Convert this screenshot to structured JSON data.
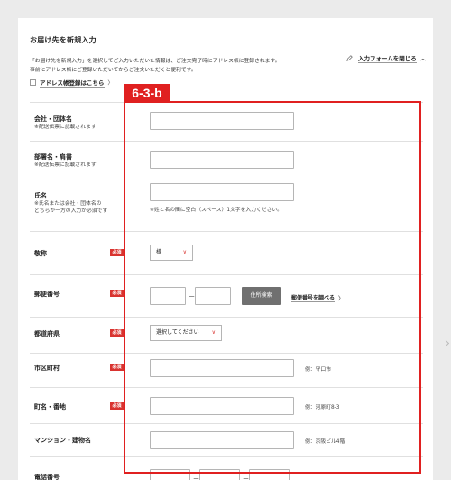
{
  "form": {
    "title": "お届け先を新規入力",
    "description": [
      "「お届け先を新規入力」を選択してご入力いただいた情報は、ご注文完了時にアドレス帳に登録されます。",
      "事前にアドレス帳にご登録いただいてからご注文いただくと便利です。"
    ],
    "close_label": "入力フォームを閉じる",
    "close_chevron": "︿",
    "address_book_label": "アドレス帳登録はこちら",
    "address_book_chevron": "〉"
  },
  "required_badge": "必須",
  "fields": {
    "company": {
      "label": "会社・団体名",
      "note": "※配送伝票に記載されます"
    },
    "department": {
      "label": "部署名・肩書",
      "note": "※配送伝票に記載されます"
    },
    "name": {
      "label": "氏名",
      "note1": "※氏名または会社・団体名の",
      "note2": "どちらか一方の入力が必須です",
      "hint": "※姓と名の間に空白（スペース）1文字を入力ください。"
    },
    "honorific": {
      "label": "敬称",
      "value": "様"
    },
    "postal": {
      "label": "郵便番号",
      "dash": "ー",
      "button": "住所検索",
      "link": "郵便番号を調べる",
      "link_chevron": "〉"
    },
    "prefecture": {
      "label": "都道府県",
      "value": "選択してください"
    },
    "city": {
      "label": "市区町村",
      "hint": "例：守口市"
    },
    "town": {
      "label": "町名・番地",
      "hint": "例：河原町8-3"
    },
    "building": {
      "label": "マンション・建物名",
      "hint": "例：京阪ビル4階"
    },
    "phone": {
      "label": "電話番号",
      "dash": "ー"
    }
  },
  "annotation": {
    "tag": "6-3-b",
    "color": "#e02020"
  }
}
